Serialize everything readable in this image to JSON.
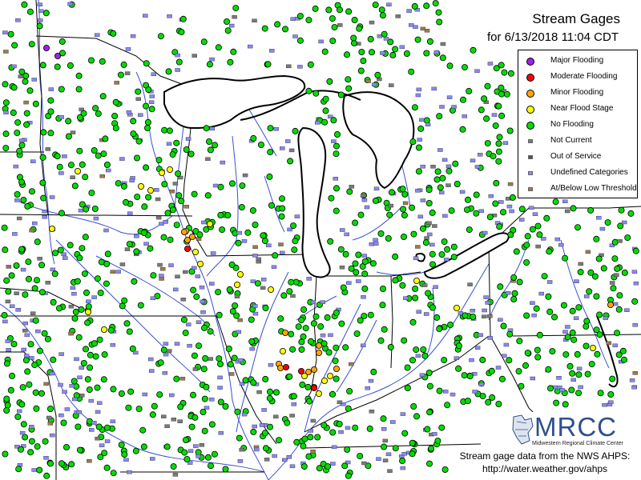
{
  "title": "Stream Gages",
  "subtitle": "for 6/13/2018 11:04 CDT",
  "legend": [
    {
      "label": "Major Flooding",
      "color": "#a020f0",
      "shape": "dot",
      "icon": "major-flooding-dot-icon"
    },
    {
      "label": "Moderate Flooding",
      "color": "#ff0000",
      "shape": "dot",
      "icon": "moderate-flooding-dot-icon"
    },
    {
      "label": "Minor Flooding",
      "color": "#ffa500",
      "shape": "dot",
      "icon": "minor-flooding-dot-icon"
    },
    {
      "label": "Near Flood Stage",
      "color": "#ffff00",
      "shape": "dot",
      "icon": "near-flood-stage-dot-icon"
    },
    {
      "label": "No Flooding",
      "color": "#00dd00",
      "shape": "dot",
      "icon": "no-flooding-dot-icon"
    },
    {
      "label": "Not Current",
      "color": "#7a7a7a",
      "shape": "square",
      "icon": "not-current-square-icon"
    },
    {
      "label": "Out of Service",
      "color": "#555555",
      "shape": "square",
      "icon": "out-of-service-square-icon"
    },
    {
      "label": "Undefined Categories",
      "color": "#8888ff",
      "shape": "square",
      "icon": "undefined-categories-square-icon"
    },
    {
      "label": "At/Below Low Threshold",
      "color": "#a07a4a",
      "shape": "square",
      "icon": "below-low-threshold-square-icon"
    }
  ],
  "logo": {
    "text": "MRCC",
    "subtext": "Midwestern Regional Climate Center"
  },
  "footer": {
    "line1": "Stream gage data from the NWS AHPS:",
    "line2": "http://water.weather.gov/ahps"
  },
  "map": {
    "water_color": "#3a4fd0",
    "border_color": "#000000",
    "state_line_color": "#000000"
  }
}
